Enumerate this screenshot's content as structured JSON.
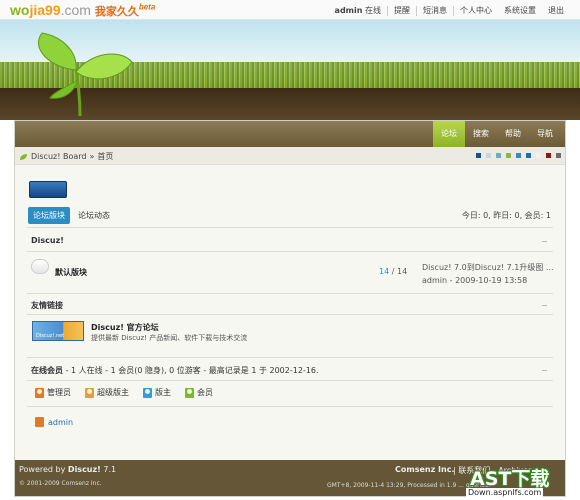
{
  "topbar": {
    "logo": {
      "part1": "wo",
      "part2": "jia99",
      "part3": ".com",
      "part4": "我家久久",
      "badge": "beta"
    },
    "nav": {
      "user": "admin",
      "status": "在线",
      "remind": "提醒",
      "messages": "短消息",
      "profile": "个人中心",
      "settings": "系统设置",
      "logout": "退出"
    }
  },
  "mainnav": {
    "tabs": [
      "论坛",
      "搜索",
      "帮助",
      "导航"
    ]
  },
  "breadcrumb": {
    "home": "Discuz! Board",
    "sep": "»",
    "current": "首页"
  },
  "swatches": [
    "#1f4f85",
    "#c8d6de",
    "#72a8c8",
    "#8fb83a",
    "#3d88b8",
    "#1f6fa8",
    "#f0f0f0",
    "#8a1818",
    "#6c6c6c"
  ],
  "subtabs": {
    "forums": "论坛版块",
    "activity": "论坛动态"
  },
  "stats": "今日: 0, 昨日: 0, 会员: 1",
  "category": {
    "title": "Discuz!"
  },
  "forum": {
    "name": "默认版块",
    "threads": "14",
    "sep": "/",
    "posts": "14",
    "last_title": "Discuz! 7.0到Discuz! 7.1升级图 ...",
    "last_author": "admin",
    "last_time": "2009-10-19 13:58"
  },
  "links": {
    "title": "友情链接",
    "logo_text": "Discuz!.net",
    "site": "Discuz! 官方论坛",
    "desc": "提供最新 Discuz! 产品新闻、软件下载与技术交流"
  },
  "online": {
    "label": "在线会员",
    "text": " - 1 人在线 - 1 会员(0 隐身), 0 位游客 - 最高记录是 1 于 2002-12-16."
  },
  "legend": [
    {
      "label": "管理员",
      "color": "#e07a2a"
    },
    {
      "label": "超级版主",
      "color": "#e0a040"
    },
    {
      "label": "版主",
      "color": "#3a9ad0"
    },
    {
      "label": "会员",
      "color": "#7ab830"
    }
  ],
  "online_user": {
    "name": "admin",
    "color": "#e07a2a"
  },
  "footer": {
    "powered_prefix": "Powered by ",
    "powered_brand": "Discuz!",
    "version": " 7.1",
    "copyright": "© 2001-2009 Comsenz Inc.",
    "company": "Comsenz Inc.",
    "links": "| 联系我们 - Archiver",
    "gmt": "GMT+8, 2009-11-4 13:29, Processed in 1.9 ... queries."
  },
  "watermark": {
    "top": "AST下载",
    "bottom": "Down.aspnlfs.com"
  }
}
